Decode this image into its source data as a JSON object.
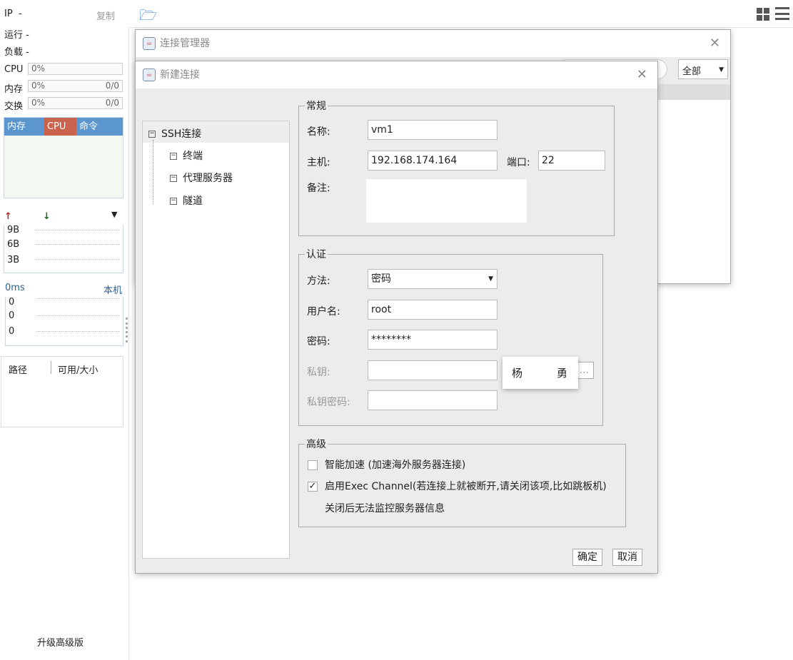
{
  "sidebar": {
    "ip_label": "IP",
    "ip_value": "-",
    "copy": "复制",
    "uptime_label": "运行",
    "uptime_value": "-",
    "load_label": "负载",
    "load_value": "-",
    "cpu_label": "CPU",
    "cpu_pct": "0%",
    "mem_label": "内存",
    "mem_pct": "0%",
    "mem_val": "0/0",
    "swap_label": "交换",
    "swap_pct": "0%",
    "swap_val": "0/0",
    "tabs": [
      {
        "label": "内存",
        "color": "#5b96cf"
      },
      {
        "label": "CPU",
        "color": "#c9634e"
      },
      {
        "label": "命令",
        "color": "#5b96cf"
      }
    ],
    "net_ticks": [
      "9B",
      "6B",
      "3B"
    ],
    "ping": "0ms",
    "ping_target": "本机",
    "ping_ticks": [
      "0",
      "0",
      "0"
    ],
    "disk_cols": [
      "路径",
      "可用/大小"
    ],
    "upgrade": "升级高级版"
  },
  "manager": {
    "title": "连接管理器",
    "filter": "全部"
  },
  "dialog": {
    "title": "新建连接",
    "tree": [
      "SSH连接",
      "终端",
      "代理服务器",
      "隧道"
    ],
    "general": {
      "legend": "常规",
      "name_label": "名称:",
      "name": "vm1",
      "host_label": "主机:",
      "host": "192.168.174.164",
      "port_label": "端口:",
      "port": "22",
      "note_label": "备注:"
    },
    "auth": {
      "legend": "认证",
      "method_label": "方法:",
      "method": "密码",
      "user_label": "用户名:",
      "user": "root",
      "pass_label": "密码:",
      "pass": "********",
      "key_label": "私钥:",
      "browse": "...",
      "keypass_label": "私钥密码:"
    },
    "advanced": {
      "legend": "高级",
      "accel": "智能加速 (加速海外服务器连接)",
      "accel_checked": false,
      "exec": "启用Exec Channel(若连接上就被断开,请关闭该项,比如跳板机)",
      "exec_checked": true,
      "exec_note": "关闭后无法监控服务器信息"
    },
    "ok": "确定",
    "cancel": "取消"
  },
  "ime_popup": [
    "杨",
    "勇"
  ]
}
